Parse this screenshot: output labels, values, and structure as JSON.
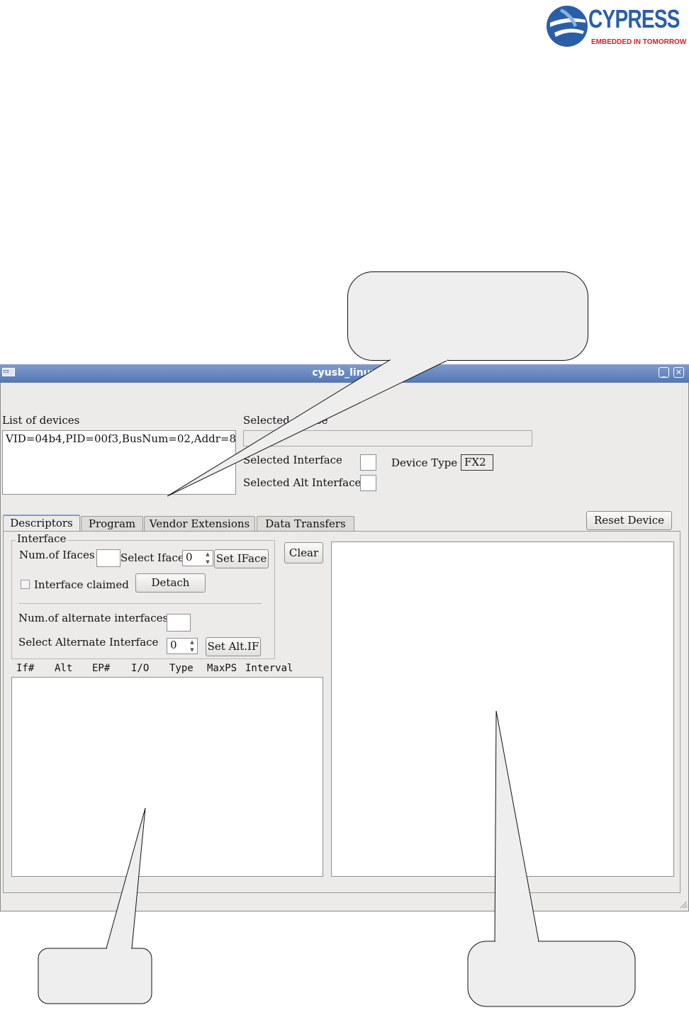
{
  "logo": {
    "word": "CYPRESS",
    "tagline": "EMBEDDED IN TOMORROW",
    "brand_color": "#2a5fa8",
    "accent_color": "#d0202a"
  },
  "window": {
    "title": "cyusb_linux",
    "titlebar_color": "#6a88bf"
  },
  "devices": {
    "label": "List of devices",
    "items": [
      "VID=04b4,PID=00f3,BusNum=02,Addr=8"
    ]
  },
  "selected": {
    "device_label": "Selected device",
    "device_value": "",
    "interface_label": "Selected Interface",
    "interface_value": "",
    "alt_label": "Selected Alt Interface",
    "alt_value": "",
    "device_type_label": "Device Type",
    "device_type_value": "FX2"
  },
  "reset_button": "Reset Device",
  "tabs": [
    "Descriptors",
    "Program",
    "Vendor Extensions",
    "Data Transfers"
  ],
  "interface_group": {
    "title": "Interface",
    "num_ifaces_label": "Num.of Ifaces",
    "num_ifaces_value": "",
    "select_iface_label": "Select Iface",
    "select_iface_value": "0",
    "set_iface_button": "Set IFace",
    "interface_claimed_label": "Interface claimed",
    "interface_claimed": false,
    "detach_button": "Detach",
    "num_alt_label": "Num.of alternate interfaces",
    "num_alt_value": "",
    "select_alt_label": "Select Alternate Interface",
    "select_alt_value": "0",
    "set_alt_button": "Set Alt.IF"
  },
  "clear_button": "Clear",
  "endpoint_columns": [
    "If#",
    "Alt",
    "EP#",
    "I/O",
    "Type",
    "MaxPS",
    "Interval"
  ],
  "icons": {
    "sysmenu": "window-menu-icon",
    "minimize": "minimize-icon",
    "close": "close-icon",
    "spin_up": "arrow-up-icon",
    "spin_down": "arrow-down-icon",
    "grip": "resize-grip-icon"
  }
}
